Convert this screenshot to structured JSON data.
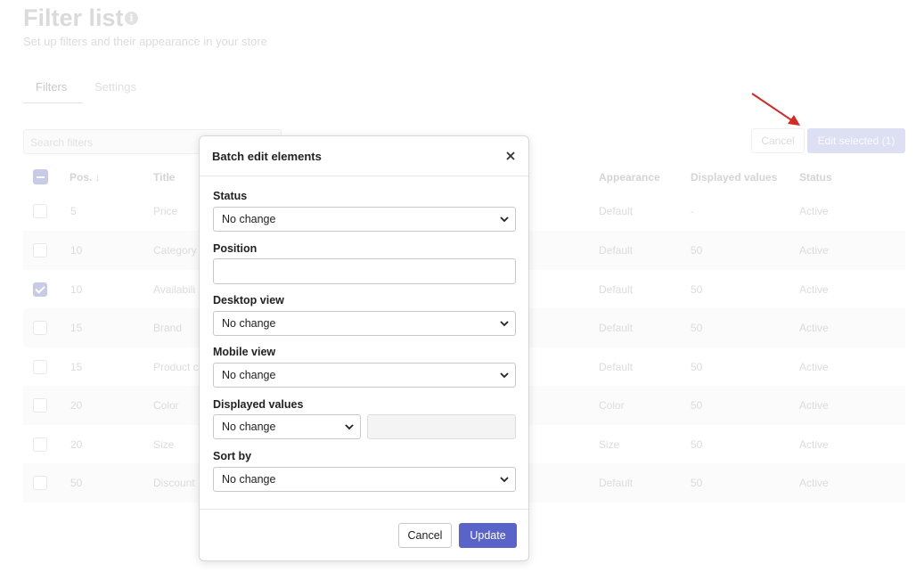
{
  "page": {
    "title": "Filter list",
    "subtitle": "Set up filters and their appearance in your store",
    "info_icon": "info-icon"
  },
  "tabs": [
    {
      "label": "Filters",
      "active": true
    },
    {
      "label": "Settings",
      "active": false
    }
  ],
  "search": {
    "placeholder": "Search filters"
  },
  "toolbar": {
    "cancel_label": "Cancel",
    "edit_selected_label": "Edit selected (1)"
  },
  "table": {
    "headers": {
      "pos": "Pos. ↓",
      "title": "Title",
      "appearance": "Appearance",
      "displayed_values": "Displayed values",
      "status": "Status"
    },
    "rows": [
      {
        "pos": "5",
        "title": "Price",
        "appearance": "Default",
        "displayed": "-",
        "status": "Active",
        "checked": false
      },
      {
        "pos": "10",
        "title": "Category",
        "appearance": "Default",
        "displayed": "50",
        "status": "Active",
        "checked": false
      },
      {
        "pos": "10",
        "title": "Availabili",
        "appearance": "Default",
        "displayed": "50",
        "status": "Active",
        "checked": true
      },
      {
        "pos": "15",
        "title": "Brand",
        "appearance": "Default",
        "displayed": "50",
        "status": "Active",
        "checked": false
      },
      {
        "pos": "15",
        "title": "Product c",
        "appearance": "Default",
        "displayed": "50",
        "status": "Active",
        "checked": false
      },
      {
        "pos": "20",
        "title": "Color",
        "appearance": "Color",
        "displayed": "50",
        "status": "Active",
        "checked": false
      },
      {
        "pos": "20",
        "title": "Size",
        "appearance": "Size",
        "displayed": "50",
        "status": "Active",
        "checked": false
      },
      {
        "pos": "50",
        "title": "Discount",
        "appearance": "Default",
        "displayed": "50",
        "status": "Active",
        "checked": false
      }
    ]
  },
  "modal": {
    "title": "Batch edit elements",
    "fields": {
      "status": {
        "label": "Status",
        "value": "No change"
      },
      "position": {
        "label": "Position",
        "value": ""
      },
      "desktop_view": {
        "label": "Desktop view",
        "value": "No change"
      },
      "mobile_view": {
        "label": "Mobile view",
        "value": "No change"
      },
      "displayed_values": {
        "label": "Displayed values",
        "value": "No change"
      },
      "sort_by": {
        "label": "Sort by",
        "value": "No change"
      }
    },
    "cancel_label": "Cancel",
    "update_label": "Update"
  },
  "colors": {
    "accent": "#5a63c8",
    "arrow": "#d42a25"
  }
}
